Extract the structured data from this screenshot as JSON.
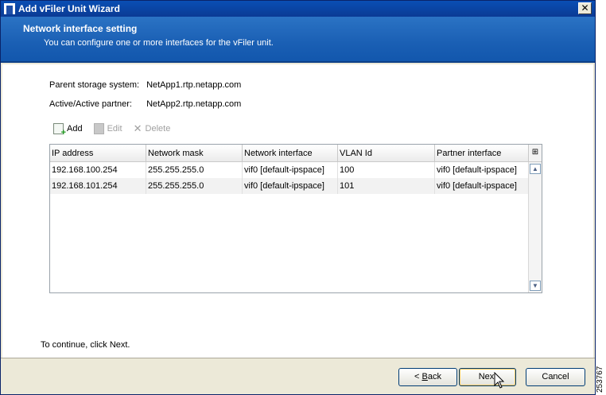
{
  "window": {
    "title": "Add vFiler Unit Wizard",
    "close_glyph": "✕"
  },
  "header": {
    "title": "Network interface setting",
    "subtitle": "You can configure one or more interfaces for the vFiler unit."
  },
  "info": {
    "parent_label": "Parent storage system:",
    "parent_value": "NetApp1.rtp.netapp.com",
    "partner_label": "Active/Active partner:",
    "partner_value": "NetApp2.rtp.netapp.com"
  },
  "toolbar": {
    "add_label": "Add",
    "edit_label": "Edit",
    "delete_label": "Delete"
  },
  "table": {
    "columns": [
      "IP address",
      "Network mask",
      "Network interface",
      "VLAN Id",
      "Partner interface"
    ],
    "rows": [
      [
        "192.168.100.254",
        "255.255.255.0",
        "vif0 [default-ipspace]",
        "100",
        "vif0 [default-ipspace]"
      ],
      [
        "192.168.101.254",
        "255.255.255.0",
        "vif0 [default-ipspace]",
        "101",
        "vif0 [default-ipspace]"
      ]
    ]
  },
  "instruction": "To continue, click Next.",
  "buttons": {
    "back_prefix": "< ",
    "back_mnemonic": "B",
    "back_rest": "ack",
    "next_label": "Next",
    "cancel_label": "Cancel"
  },
  "side_caption": "253767",
  "colors": {
    "header_blue": "#1a5fb4",
    "title_bar": "#0a3a94",
    "dialog_bg": "#ece9d8"
  }
}
